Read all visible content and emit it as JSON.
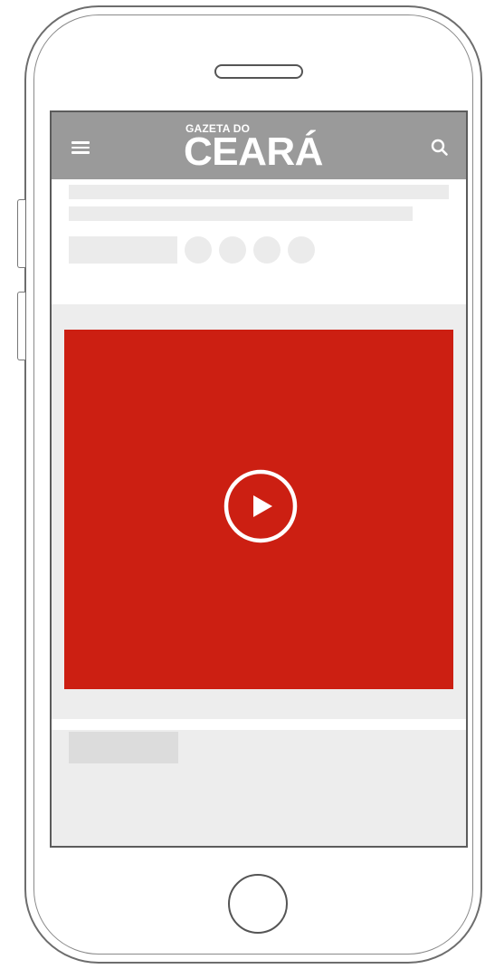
{
  "app": {
    "logo_small": "GAZETA DO",
    "logo_big": "CEARÁ"
  },
  "icons": {
    "menu": "hamburger-menu-icon",
    "search": "magnifier-icon",
    "play": "play-triangle-icon"
  },
  "colors": {
    "appbar": "#9a9a9a",
    "video": "#cc1f12",
    "placeholder": "#ebebeb",
    "screen_background": "#ededed"
  }
}
